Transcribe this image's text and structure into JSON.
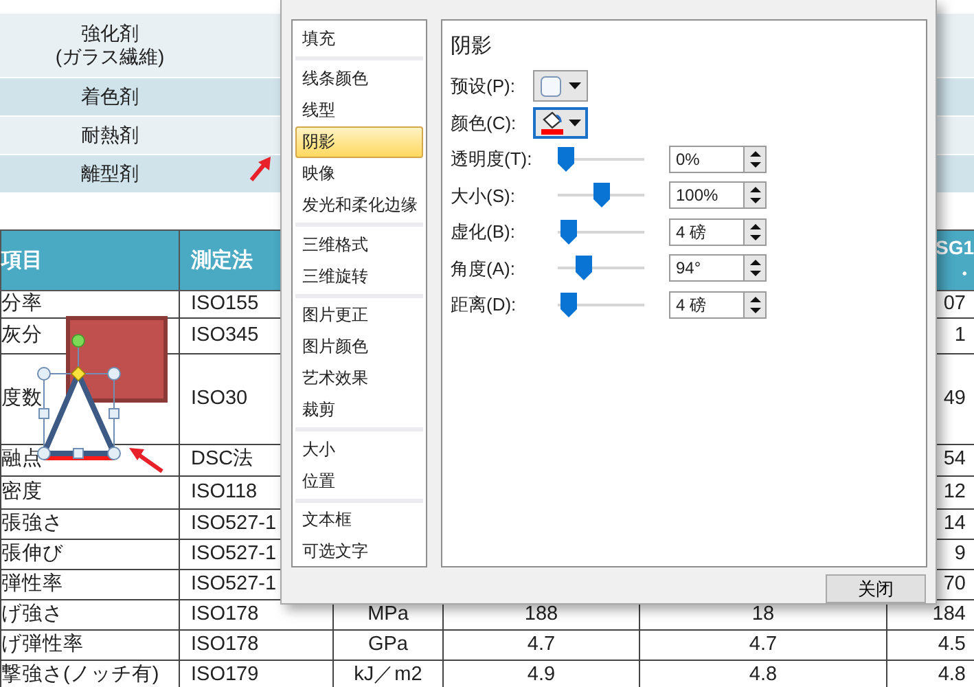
{
  "band": {
    "rows": [
      {
        "label": "強化剤\n(ガラス繊維)"
      },
      {
        "label": "着色剤"
      },
      {
        "label": "耐熱剤"
      },
      {
        "label": "離型剤"
      }
    ]
  },
  "table": {
    "header": {
      "item": "項目",
      "method": "測定法",
      "col_6": "SG1\n・"
    },
    "rows": [
      {
        "item": "分率",
        "method": "ISO155",
        "col_6": "07"
      },
      {
        "item": "灰分",
        "method": "ISO345",
        "col_6": "1"
      },
      {
        "item": "度数",
        "method": "ISO30",
        "col_6": "49"
      },
      {
        "item": "融点",
        "method": "DSC法",
        "col_6": "54"
      },
      {
        "item": "密度",
        "method": "ISO118",
        "col_6": "12"
      },
      {
        "item": "張強さ",
        "method": "ISO527-1",
        "col_6": "14"
      },
      {
        "item": "張伸び",
        "method": "ISO527-1",
        "col_6": "9"
      },
      {
        "item": "弾性率",
        "method": "ISO527-1",
        "col_6": "70"
      },
      {
        "item": "げ強さ",
        "method": "ISO178",
        "unit": "MPa",
        "col_4": "188",
        "col_5": "18",
        "col_6": "184"
      },
      {
        "item": "げ弾性率",
        "method": "ISO178",
        "unit": "GPa",
        "col_4": "4.7",
        "col_5": "4.7",
        "col_6": "4.5"
      },
      {
        "item": "撃強さ(ノッチ有)",
        "method": "ISO179",
        "unit": "kJ／m2",
        "col_4": "4.9",
        "col_5": "4.8",
        "col_6": "4.8"
      }
    ]
  },
  "dialog": {
    "nav_groups": [
      [
        {
          "label": "填充",
          "selected": false
        }
      ],
      [
        {
          "label": "线条颜色",
          "selected": false
        },
        {
          "label": "线型",
          "selected": false
        },
        {
          "label": "阴影",
          "selected": true
        },
        {
          "label": "映像",
          "selected": false
        },
        {
          "label": "发光和柔化边缘",
          "selected": false
        }
      ],
      [
        {
          "label": "三维格式",
          "selected": false
        },
        {
          "label": "三维旋转",
          "selected": false
        }
      ],
      [
        {
          "label": "图片更正",
          "selected": false
        },
        {
          "label": "图片颜色",
          "selected": false
        },
        {
          "label": "艺术效果",
          "selected": false
        },
        {
          "label": "裁剪",
          "selected": false
        }
      ],
      [
        {
          "label": "大小",
          "selected": false
        },
        {
          "label": "位置",
          "selected": false
        }
      ],
      [
        {
          "label": "文本框",
          "selected": false
        },
        {
          "label": "可选文字",
          "selected": false
        }
      ]
    ],
    "panel": {
      "title": "阴影",
      "controls": [
        {
          "kind": "preset",
          "label": "预设(P):"
        },
        {
          "kind": "color",
          "label": "颜色(C):",
          "color": "#ff0000"
        },
        {
          "kind": "slider",
          "label": "透明度(T):",
          "level": 0,
          "value": "0%"
        },
        {
          "kind": "slider",
          "label": "大小(S):",
          "level": 0.5,
          "value": "100%"
        },
        {
          "kind": "slider",
          "label": "虚化(B):",
          "level": 0.04,
          "value": "4 磅"
        },
        {
          "kind": "slider",
          "label": "角度(A):",
          "level": 0.26,
          "value": "94°"
        },
        {
          "kind": "slider",
          "label": "距离(D):",
          "level": 0.03,
          "value": "4 磅"
        }
      ]
    },
    "close_button": "关闭"
  }
}
